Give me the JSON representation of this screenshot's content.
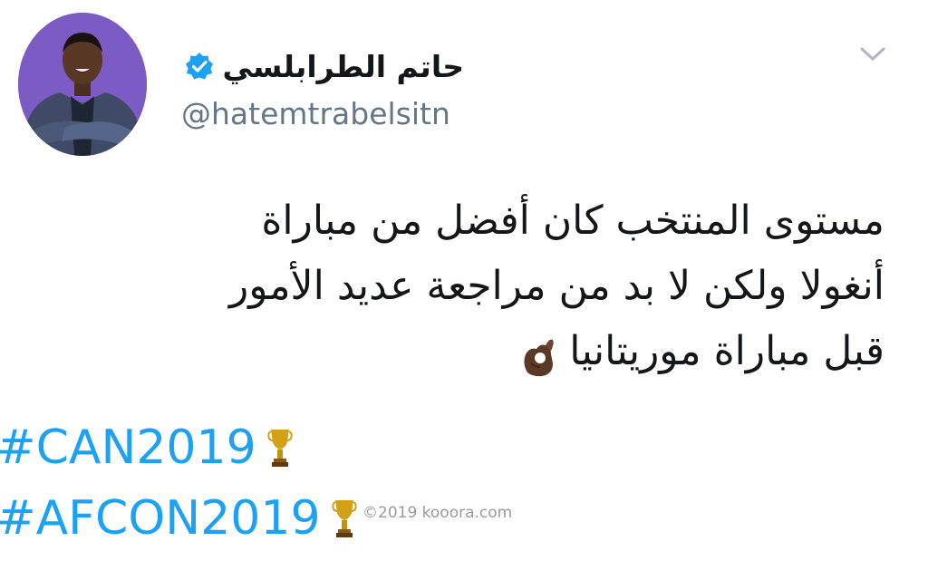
{
  "user": {
    "display_name": "حاتم الطرابلسي",
    "handle": "@hatemtrabelsitn"
  },
  "tweet": {
    "lines": [
      "مستوى المنتخب كان أفضل من مباراة",
      "أنغولا ولكن لا بد من مراجعة عديد الأمور",
      "قبل مباراة موريتانيا"
    ],
    "hashtags": [
      "#CAN2019",
      "#AFCON2019"
    ]
  },
  "icons": {
    "menu": "chevron-down-icon",
    "verified": "verified-badge-icon",
    "emoji": "ok-hand-emoji-icon",
    "trophy": "trophy-emoji-icon"
  },
  "watermark": "©2019 kooora.com",
  "colors": {
    "link": "#1da1f2",
    "verified": "#1da1f2",
    "secondary_text": "#657786",
    "avatar_bg": "#7c5cc4"
  }
}
